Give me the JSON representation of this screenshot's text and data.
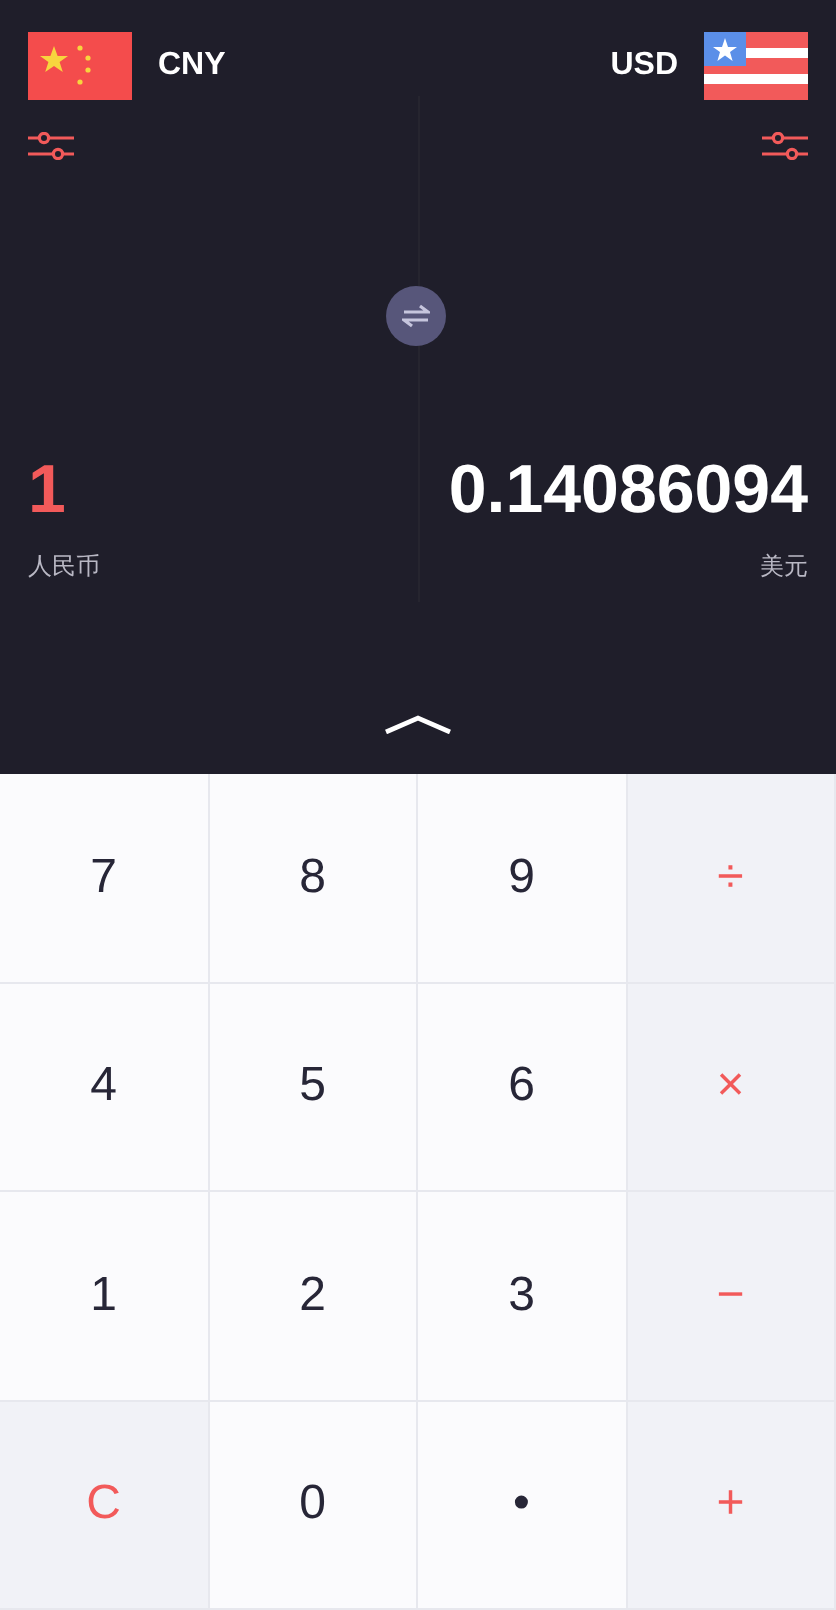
{
  "currencies": [
    {
      "code": "CNY",
      "kind": "cn",
      "amount": "1",
      "name": "人民币",
      "selected": true
    },
    {
      "code": "USD",
      "kind": "us",
      "amount": "0.14086094",
      "name": "美元",
      "selected": false
    }
  ],
  "keys": [
    {
      "label": "7",
      "kind": "digit"
    },
    {
      "label": "8",
      "kind": "digit"
    },
    {
      "label": "9",
      "kind": "digit"
    },
    {
      "label": "÷",
      "kind": "operator"
    },
    {
      "label": "4",
      "kind": "digit"
    },
    {
      "label": "5",
      "kind": "digit"
    },
    {
      "label": "6",
      "kind": "digit"
    },
    {
      "label": "×",
      "kind": "operator"
    },
    {
      "label": "1",
      "kind": "digit"
    },
    {
      "label": "2",
      "kind": "digit"
    },
    {
      "label": "3",
      "kind": "digit"
    },
    {
      "label": "−",
      "kind": "operator"
    },
    {
      "label": "C",
      "kind": "clear"
    },
    {
      "label": "0",
      "kind": "digit"
    },
    {
      "label": "•",
      "kind": "digit"
    },
    {
      "label": "+",
      "kind": "operator"
    }
  ]
}
